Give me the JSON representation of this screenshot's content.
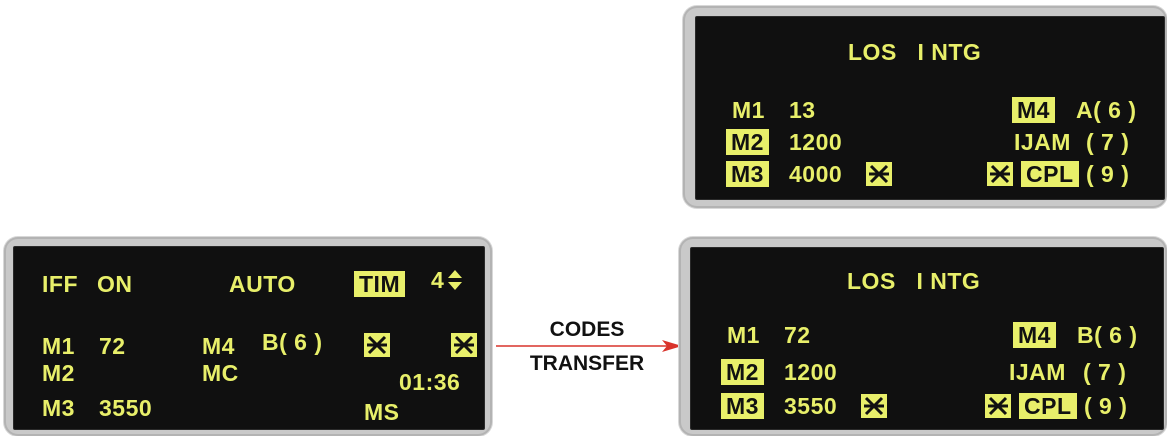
{
  "colors": {
    "display_text": "#e8ef6a",
    "screen_bg": "#101010",
    "bezel": "#c9c9c9",
    "arrow": "#d9332b"
  },
  "left_display": {
    "iff": "IFF",
    "on": "ON",
    "auto": "AUTO",
    "tim": "TIM",
    "tim_value": "4",
    "arrow_icon": "up-down-triangle-icon",
    "m1": "M1",
    "m1_value": "72",
    "m2": "M2",
    "m3": "M3",
    "m3_value": "3550",
    "m4": "M4",
    "m4_value": "B( 6 )",
    "mc": "MC",
    "ms": "MS",
    "time": "01:36"
  },
  "transfer": {
    "line1": "CODES",
    "line2": "TRANSFER"
  },
  "top_right_display": {
    "title": "LOS   I NTG",
    "m1": "M1",
    "m1_value": "13",
    "m2": "M2",
    "m2_value": "1200",
    "m3": "M3",
    "m3_value": "4000",
    "m4": "M4",
    "m4_value": "A( 6 )",
    "ijam": "IJAM",
    "ijam_value": "( 7 )",
    "cpl": "CPL",
    "cpl_value": "( 9 )"
  },
  "bottom_right_display": {
    "title": "LOS   I NTG",
    "m1": "M1",
    "m1_value": "72",
    "m2": "M2",
    "m2_value": "1200",
    "m3": "M3",
    "m3_value": "3550",
    "m4": "M4",
    "m4_value": "B( 6 )",
    "ijam": "IJAM",
    "ijam_value": "( 7 )",
    "cpl": "CPL",
    "cpl_value": "( 9 )"
  }
}
